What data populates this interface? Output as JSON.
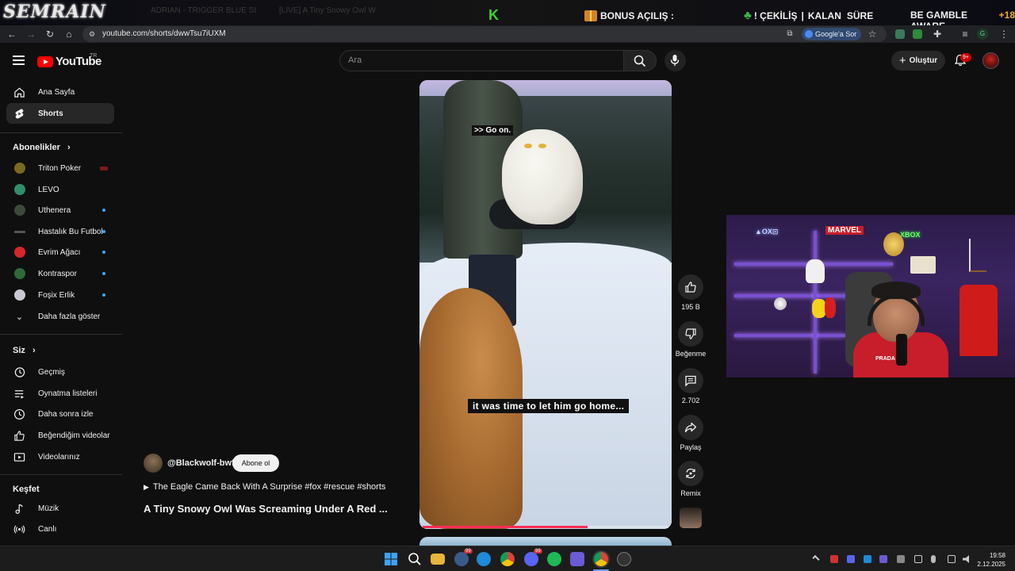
{
  "overlay": {
    "logo": "SEMRAIN",
    "ghost_tabs": [
      "ADRIAN - TRIGGER BLUE SI",
      "[LIVE] A Tiny Snowy Owl W"
    ],
    "k_letter": "K",
    "bonus_label": "BONUS AÇILIŞ :",
    "cekilis_label": "! ÇEKİLİŞ",
    "kalan_label": "KALAN",
    "sure_label": "SÜRE",
    "gamble_text": "BE GAMBLE AWARE",
    "age_text": "+18"
  },
  "browser": {
    "url": "youtube.com/shorts/dwwTsu7iUXM",
    "google_sor_label": "Google'a Sor",
    "profile_letter": "G",
    "ext_badge_1": "78",
    "ext_badge_2": "10"
  },
  "header": {
    "wordmark": "YouTube",
    "country": "TR",
    "search_placeholder": "Ara",
    "create_label": "Oluştur",
    "notif_badge": "9+"
  },
  "sidebar": {
    "main": [
      {
        "label": "Ana Sayfa",
        "icon": "home-icon"
      },
      {
        "label": "Shorts",
        "icon": "shorts-icon"
      }
    ],
    "subscriptions_title": "Abonelikler",
    "channels": [
      {
        "name": "Triton Poker",
        "color": "#7a6a1e"
      },
      {
        "name": "LEVO",
        "color": "#2f8f6a"
      },
      {
        "name": "Uthenera",
        "color": "#3c4a3a"
      },
      {
        "name": "Hastalık Bu Futbol",
        "color": "#555555"
      },
      {
        "name": "Evrim Ağacı",
        "color": "#d9242a"
      },
      {
        "name": "Kontraspor",
        "color": "#2d6a3a"
      },
      {
        "name": "Foşix Erlik",
        "color": "#c9c9d4"
      }
    ],
    "show_more": "Daha fazla göster",
    "you_title": "Siz",
    "you_items": [
      {
        "label": "Geçmiş",
        "icon": "history-icon"
      },
      {
        "label": "Oynatma listeleri",
        "icon": "playlist-icon"
      },
      {
        "label": "Daha sonra izle",
        "icon": "watch-later-icon"
      },
      {
        "label": "Beğendiğim videolar",
        "icon": "liked-icon"
      },
      {
        "label": "Videolarınız",
        "icon": "your-videos-icon"
      }
    ],
    "explore_title": "Keşfet",
    "explore_items": [
      {
        "label": "Müzik",
        "icon": "music-icon"
      },
      {
        "label": "Canlı",
        "icon": "live-icon"
      }
    ]
  },
  "short": {
    "caption_top": ">> Go on.",
    "caption_bottom": "it was time to let him go home...",
    "progress_fraction": 0.67,
    "channel": "@Blackwolf-bwf",
    "subscribe_label": "Abone ol",
    "playlist_text": "The Eagle Came Back With A Surprise #fox #rescue #shorts",
    "title": "A Tiny Snowy Owl Was Screaming Under A Red ...",
    "likes": "195 B",
    "dislike_label": "Beğenme",
    "comments": "2.702",
    "share_label": "Paylaş",
    "remix_label": "Remix"
  },
  "webcam": {
    "neon_1": "▲OX⊡",
    "neon_2": "MARVEL",
    "neon_3": "XBOX",
    "jersey_text": "PRADA"
  },
  "taskbar": {
    "time": "19:58",
    "date": "2.12.2025",
    "badge_chrome": "99",
    "badge_discord": "99"
  },
  "colors": {
    "yt_red": "#ff0000",
    "progress": "#ff2d55",
    "bonus_gold": "#f1b12a"
  }
}
